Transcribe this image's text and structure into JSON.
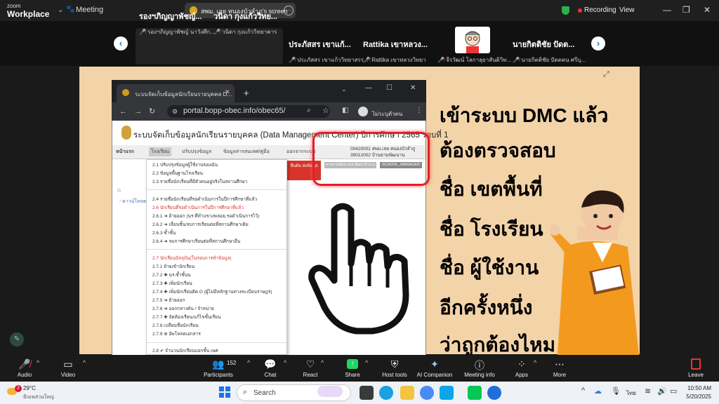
{
  "topbar": {
    "brand_line1": "zoom",
    "brand_line2": "Workplace",
    "meeting_label": "Meeting",
    "share_label": "สพม. เลย หนองบัวลำภู's screen",
    "recording_label": "Recording",
    "view_label": "View"
  },
  "participants": [
    {
      "name": "รองฯภิญญาพัชญ์...",
      "sub": "รองฯภิญญาพัชญ์ นาวังศึก..."
    },
    {
      "name": "วนิดา กุงแก้ววิทย...",
      "sub": "วนิดา กุงแก้ววิทยาคาร"
    },
    {
      "name": "ประภัสสร เขาแก้...",
      "sub": "ประภัสสร เขาแก้ววิทยาสรร..."
    },
    {
      "name": "Rattika เขาหลวง...",
      "sub": "Rattika เขาหลวงวิทยา"
    },
    {
      "name": "",
      "sub": "จีรวัฒน์ โลกาลุยาสันติวิท..."
    },
    {
      "name": "นายกิตติชัย ปัดต...",
      "sub": "นายกิตติชัย ปัดตคน ศรีบุ..."
    }
  ],
  "browser": {
    "tab_title": "ระบบจัดเก็บข้อมูลนักเรียนรายบุคคล D...",
    "url": "portal.bopp-obec.info/obec65/",
    "profile": "ไม่ระบุตัวตน"
  },
  "site": {
    "title": "ระบบจัดเก็บข้อมูลนักเรียนรายบุคคล (Data Management Center) ปีการศึกษา 2565 รอบที่ 1",
    "menu": [
      "หน้าแรก",
      "โรงเรียน",
      "ปรับปรุงข้อมูล",
      "ข้อมูลสารสนเทศ/คู่มือ",
      "ออกจากระบบ"
    ],
    "school_line1": "00420001 สพม.เลย หนองบัวลำภู",
    "school_line2": "39012002 บ้านยามพัฒนาน",
    "area_badge": "ทางสายพัฒนาเขต พัฒนาบ้านวง",
    "role_badge": "SCHOOL_MANAGER",
    "red_button": "ยืนยัน ส่งข้อมูล",
    "download_link": "- ดาวน์โหลด",
    "dropdown": [
      {
        "text": "2.1 ปรับปรุงข้อมูลผู้ใช้งานของฉัน",
        "red": false
      },
      {
        "text": "2.2 ข้อมูลพื้นฐานโรงเรียน",
        "red": false
      },
      {
        "text": "2.3 รายชื่อนักเรียนที่มีตัวตนอยู่จริงในสถานศึกษา",
        "red": false
      },
      {
        "text": "2.4 รายชื่อนักเรียนที่รอดำเนินการในปีการศึกษาที่แล้ว",
        "red": false
      },
      {
        "text": "2.6 นักเรียนที่รอดำเนินการในปีการศึกษาที่แล้ว",
        "red": true
      },
      {
        "text": "2.6.1 ➜ ย้ายออก (นร.ที่ทำแขวงพลอย,รอดำเนินการไว้)",
        "red": false
      },
      {
        "text": "2.6.2 ➜ เลื่อนชั้น/จบการเรียนต่อที่สถานศึกษาเดิม",
        "red": false
      },
      {
        "text": "2.6.3 ซ้ำชั้น",
        "red": false
      },
      {
        "text": "2.6.4 ➜ จบการศึกษาเรียนต่อที่สถานศึกษาอื่น",
        "red": false
      },
      {
        "text": "2.7 นักเรียนปัจจุบัน(ในรอบการทำข้อมูล)",
        "red": true
      },
      {
        "text": "2.7.1 ย้ายเข้านักเรียน",
        "red": false
      },
      {
        "text": "2.7.2 ✚ นร.ซ้ำชั้นน",
        "red": false
      },
      {
        "text": "2.7.3 ✚ เพิ่มนักเรียน",
        "red": false
      },
      {
        "text": "2.7.4 ✚ เพิ่มนักเรียนติด G (ผู้ไม่มีหลักฐานทางทะเบียนราษฎร)",
        "red": false
      },
      {
        "text": "2.7.5 ➜ ย้ายออก",
        "red": false
      },
      {
        "text": "2.7.6 ➜ ออกกลางคัน / จำหน่าย",
        "red": false
      },
      {
        "text": "2.7.7 ✚ จัดห้องเรียน/แก้ไขชั้นเรียน",
        "red": false
      },
      {
        "text": "2.7.8 เปลี่ยนชื่อนักเรียน",
        "red": false
      },
      {
        "text": "2.7.9 ⊕ อัพโหลดเอกสาร",
        "red": false
      },
      {
        "text": "2.8 ✔ จำนวนนักเรียนแยกชั้น เพศ",
        "red": false
      }
    ]
  },
  "slide_lines": [
    "เข้าระบบ DMC แล้ว",
    "ต้องตรวจสอบ",
    "ชื่อ เขตพื้นที่",
    "ชื่อ โรงเรียน",
    "ชื่อ ผู้ใช้งาน",
    "อีกครั้งหนึ่ง",
    "ว่าถูกต้องไหม"
  ],
  "toolbar": {
    "audio": "Audio",
    "video": "Video",
    "participants": "Participants",
    "participants_count": "152",
    "chat": "Chat",
    "react": "React",
    "share": "Share",
    "host_tools": "Host tools",
    "ai_companion": "AI Companion",
    "meeting_info": "Meeting info",
    "apps": "Apps",
    "more": "More",
    "leave": "Leave"
  },
  "taskbar": {
    "temp": "29°C",
    "weather_desc": "มีเมฆส่วนใหญ่",
    "weather_badge": "2",
    "search_placeholder": "Search",
    "lang": "ไทย",
    "time": "10:50 AM",
    "date": "5/20/2025"
  }
}
